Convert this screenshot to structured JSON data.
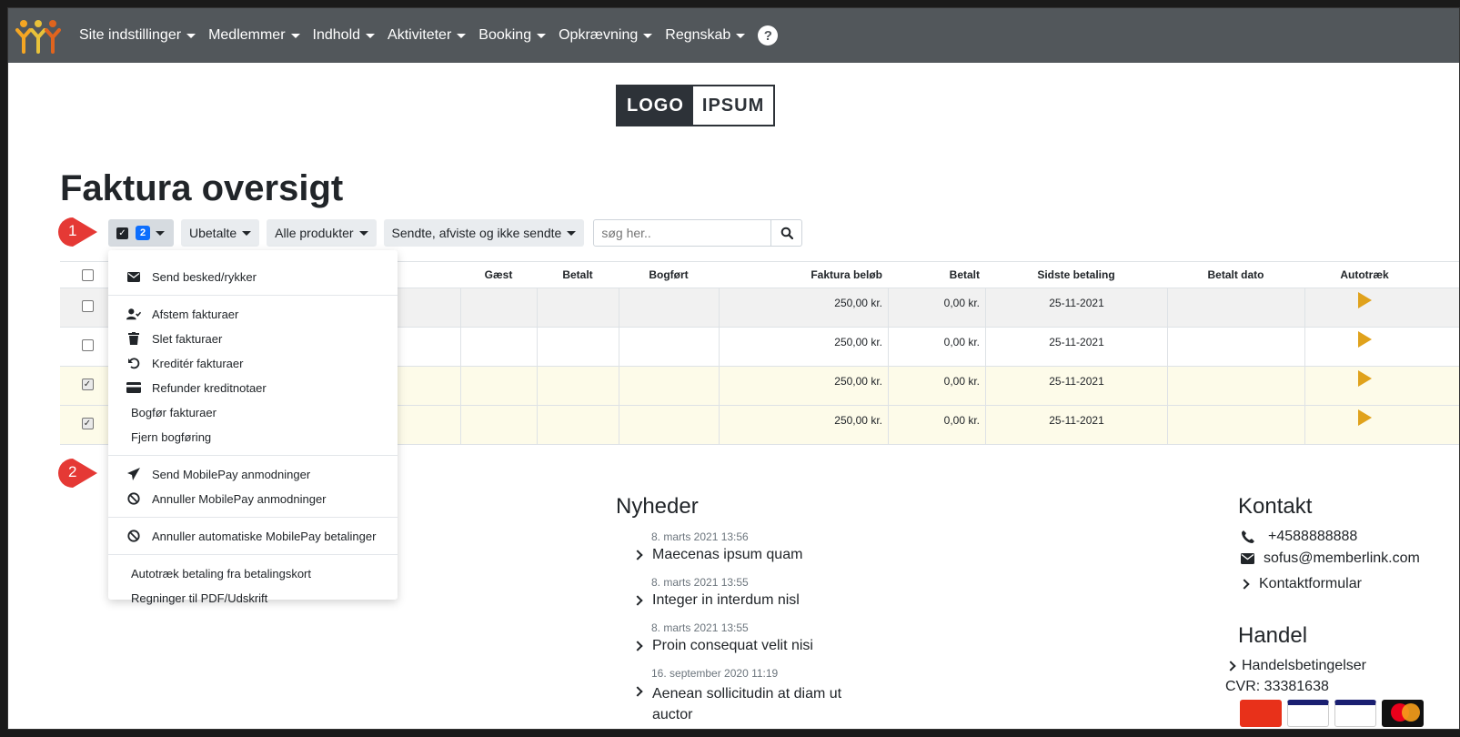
{
  "navbar": {
    "items": [
      {
        "label": "Site indstillinger"
      },
      {
        "label": "Medlemmer"
      },
      {
        "label": "Indhold"
      },
      {
        "label": "Aktiviteter"
      },
      {
        "label": "Booking"
      },
      {
        "label": "Opkrævning"
      },
      {
        "label": "Regnskab"
      }
    ],
    "help_label": "?"
  },
  "logo": {
    "part_a": "LOGO",
    "part_b": "IPSUM"
  },
  "page_title": "Faktura oversigt",
  "toolbar": {
    "selected_count": "2",
    "filter_status": "Ubetalte",
    "filter_products": "Alle produkter",
    "filter_sent": "Sendte, afviste og ikke sendte",
    "search_placeholder": "søg her.."
  },
  "table": {
    "headers": {
      "gaest": "Gæst",
      "betalt": "Betalt",
      "bogfort": "Bogført",
      "belob": "Faktura beløb",
      "betalt2": "Betalt",
      "sidste": "Sidste betaling",
      "dato": "Betalt dato",
      "auto": "Autotræk"
    },
    "rows": [
      {
        "checked": false,
        "amount": "250,00 kr.",
        "paid": "0,00 kr.",
        "last_payment": "25-11-2021"
      },
      {
        "checked": false,
        "amount": "250,00 kr.",
        "paid": "0,00 kr.",
        "last_payment": "25-11-2021"
      },
      {
        "checked": true,
        "amount": "250,00 kr.",
        "paid": "0,00 kr.",
        "last_payment": "25-11-2021"
      },
      {
        "checked": true,
        "amount": "250,00 kr.",
        "paid": "0,00 kr.",
        "last_payment": "25-11-2021"
      }
    ]
  },
  "dropdown": {
    "send_message": "Send besked/rykker",
    "reconcile": "Afstem fakturaer",
    "delete": "Slet fakturaer",
    "credit": "Kreditér fakturaer",
    "refund": "Refunder kreditnotaer",
    "post": "Bogfør fakturaer",
    "unpost": "Fjern bogføring",
    "send_mobilepay": "Send MobilePay anmodninger",
    "cancel_mobilepay": "Annuller MobilePay anmodninger",
    "cancel_auto_mobilepay": "Annuller automatiske MobilePay betalinger",
    "auto_card": "Autotræk betaling fra betalingskort",
    "pdf": "Regninger til PDF/Udskrift"
  },
  "markers": {
    "first": "1",
    "second": "2"
  },
  "news": {
    "title": "Nyheder",
    "items": [
      {
        "date": "8. marts 2021 13:56",
        "title": "Maecenas ipsum quam"
      },
      {
        "date": "8. marts 2021 13:55",
        "title": "Integer in interdum nisl"
      },
      {
        "date": "8. marts 2021 13:55",
        "title": "Proin consequat velit nisi"
      },
      {
        "date": "16. september 2020 11:19",
        "title": "Aenean sollicitudin at diam ut auctor"
      }
    ]
  },
  "contact": {
    "title": "Kontakt",
    "phone": "+4588888888",
    "email": "sofus@memberlink.com",
    "form": "Kontaktformular"
  },
  "trade": {
    "title": "Handel",
    "terms": "Handelsbetingelser",
    "cvr": "CVR: 33381638"
  },
  "colors": {
    "navbar": "#52575b",
    "accent": "#0d6efd",
    "play": "#e0a21c",
    "marker": "#e53935",
    "selected_row": "#fdfbe9"
  }
}
